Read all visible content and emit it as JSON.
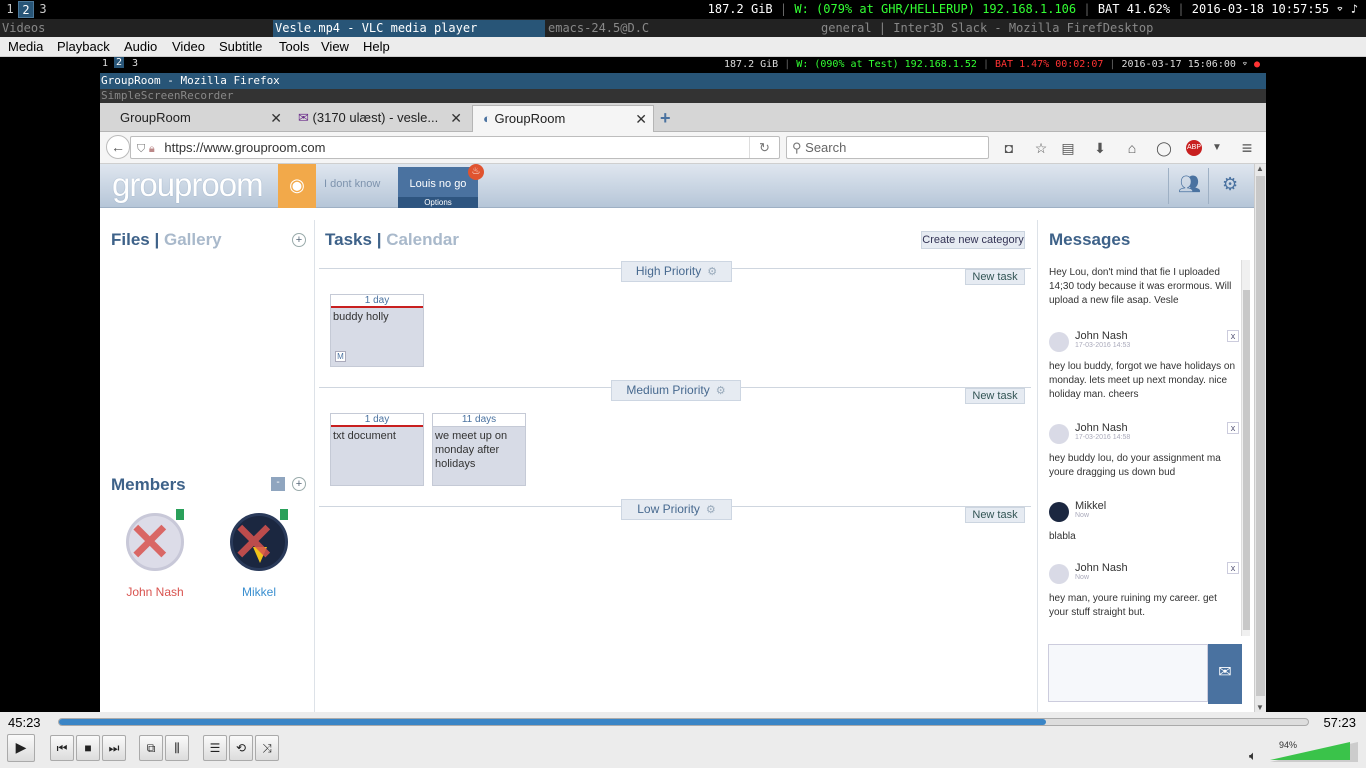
{
  "topbar": {
    "workspaces": [
      "1",
      "2",
      "3"
    ],
    "active_workspace": "2",
    "disk": "187.2 GiB",
    "wifi": "W: (079% at GHR/HELLERUP) 192.168.1.106",
    "battery": "BAT 41.62%",
    "datetime": "2016-03-18 10:57:55"
  },
  "window_titles": {
    "left": "Videos",
    "vlc": "Vesle.mp4 - VLC media player",
    "emacs": "emacs-24.5@D.C",
    "slack": "general | Inter3D Slack - Mozilla FirefDesktop"
  },
  "vlc_menu": [
    "Media",
    "Playback",
    "Audio",
    "Video",
    "Subtitle",
    "Tools",
    "View",
    "Help"
  ],
  "inner_bar": {
    "workspaces": [
      "1",
      "2",
      "3"
    ],
    "disk": "187.2 GiB",
    "wifi": "W: (090% at Test) 192.168.1.52",
    "battery": "BAT 1.47% 00:02:07",
    "datetime": "2016-03-17 15:06:00"
  },
  "firefox_title": "GroupRoom - Mozilla Firefox",
  "recorder_title": "SimpleScreenRecorder",
  "tabs": [
    {
      "label": "GroupRoom"
    },
    {
      "label": "(3170 ulæst) - vesle..."
    },
    {
      "label": "GroupRoom"
    }
  ],
  "url": "https://www.grouproom.com",
  "search_placeholder": "Search",
  "app": {
    "logo": "grouproom",
    "nav_tab_1": "I dont know",
    "nav_tab_2": "Louis no go",
    "nav_tab_2_sub": "Options",
    "files_title": "Files",
    "gallery_title": "Gallery",
    "sep": "|",
    "tasks_title": "Tasks",
    "calendar_title": "Calendar",
    "create_category": "Create new category",
    "messages_title": "Messages",
    "members_title": "Members",
    "new_task": "New task",
    "priorities": [
      {
        "name": "High Priority",
        "tasks": [
          {
            "due": "1 day",
            "title": "buddy holly",
            "badge": "M"
          }
        ]
      },
      {
        "name": "Medium Priority",
        "tasks": [
          {
            "due": "1 day",
            "title": "txt document"
          },
          {
            "due": "11 days",
            "title": "we meet up on monday after holidays"
          }
        ]
      },
      {
        "name": "Low Priority",
        "tasks": []
      }
    ],
    "members": [
      {
        "name": "John Nash",
        "color": "#d9534f"
      },
      {
        "name": "Mikkel",
        "color": "#3a8fd0"
      }
    ],
    "messages": [
      {
        "text": "Hey Lou, don't mind that fie I uploaded 14;30 tody because it was erormous. Will upload a new file asap. Vesle"
      },
      {
        "author": "John Nash",
        "time": "17-03-2016 14:53",
        "text": "hey lou buddy, forgot we have holidays on monday. lets meet up next monday. nice holiday man. cheers"
      },
      {
        "author": "John Nash",
        "time": "17-03-2016 14:58",
        "text": "hey buddy lou, do your assignment ma youre dragging us down bud"
      },
      {
        "author": "Mikkel",
        "time": "Now",
        "text": "blabla"
      },
      {
        "author": "John Nash",
        "time": "Now",
        "text": "hey man, youre ruining my career. get your stuff straight but."
      }
    ]
  },
  "vlc": {
    "elapsed": "45:23",
    "total": "57:23",
    "progress": 0.79,
    "volume": "94%"
  }
}
